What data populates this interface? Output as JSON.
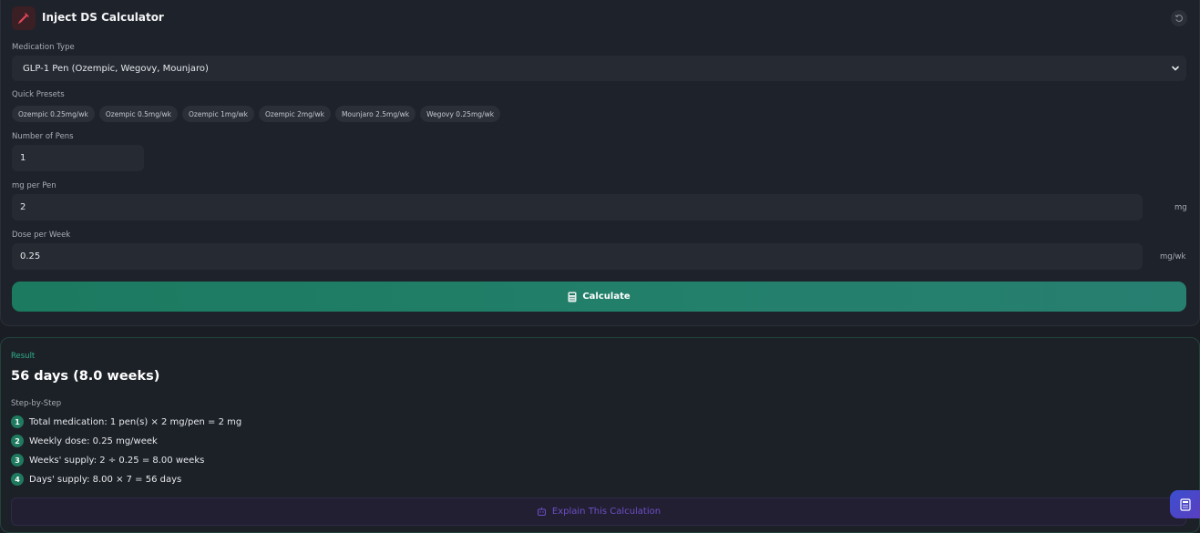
{
  "header": {
    "title": "Inject DS Calculator",
    "app_icon": "syringe-icon",
    "reset_icon": "reset-icon"
  },
  "form": {
    "medication_type": {
      "label": "Medication Type",
      "value": "GLP-1 Pen (Ozempic, Wegovy, Mounjaro)"
    },
    "quick_presets": {
      "label": "Quick Presets",
      "items": [
        "Ozempic 0.25mg/wk",
        "Ozempic 0.5mg/wk",
        "Ozempic 1mg/wk",
        "Ozempic 2mg/wk",
        "Mounjaro 2.5mg/wk",
        "Wegovy 0.25mg/wk"
      ]
    },
    "num_pens": {
      "label": "Number of Pens",
      "value": "1"
    },
    "mg_per_pen": {
      "label": "mg per Pen",
      "value": "2",
      "unit": "mg"
    },
    "dose_per_week": {
      "label": "Dose per Week",
      "value": "0.25",
      "unit": "mg/wk"
    },
    "calculate_label": "Calculate"
  },
  "result": {
    "label": "Result",
    "value": "56 days (8.0 weeks)",
    "steps_label": "Step-by-Step",
    "steps": [
      {
        "num": "1",
        "text": "Total medication: 1 pen(s) × 2 mg/pen = 2 mg"
      },
      {
        "num": "2",
        "text": "Weekly dose: 0.25 mg/week"
      },
      {
        "num": "3",
        "text": "Weeks' supply: 2 ÷ 0.25 = 8.00 weeks"
      },
      {
        "num": "4",
        "text": "Days' supply: 8.00 × 7 = 56 days"
      }
    ],
    "explain_label": "Explain This Calculation"
  },
  "colors": {
    "background": "#1a1d24",
    "card": "#1e222a",
    "accent_green": "#1f7a5f",
    "result_label": "#2fb08a",
    "explain_purple": "#6d4fc6",
    "float_button": "#4a47c8"
  }
}
